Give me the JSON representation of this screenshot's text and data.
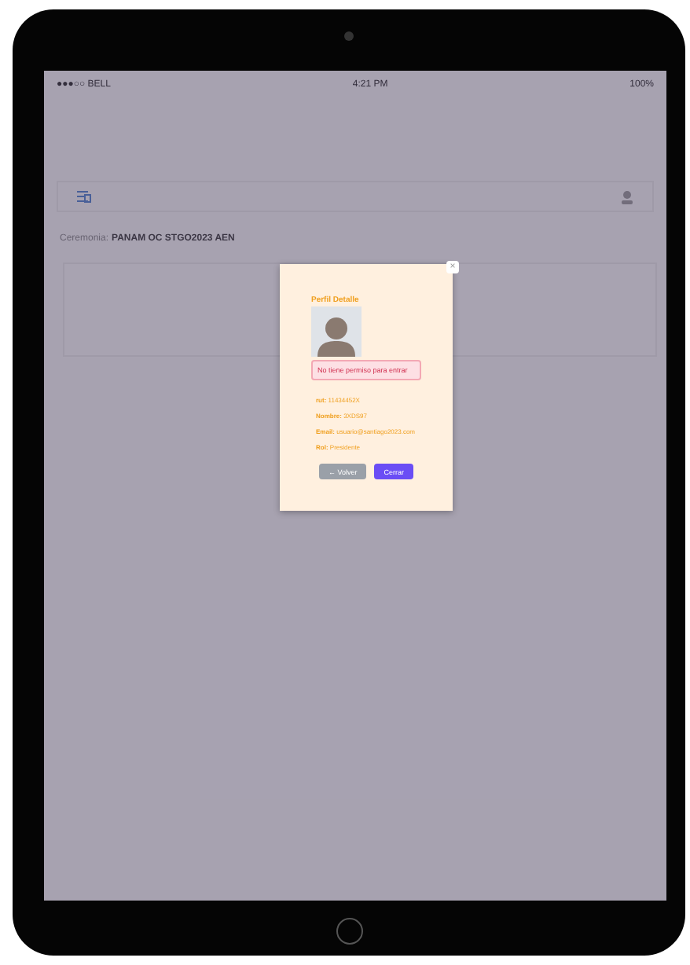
{
  "status_bar": {
    "carrier": "●●●○○ BELL",
    "time": "4:21 PM",
    "battery": "100%"
  },
  "header": {
    "label": "Ceremonia:",
    "value": "PANAM OC STGO2023 AEN"
  },
  "modal": {
    "title": "Perfil Detalle",
    "alert": "No tiene permiso para entrar",
    "fields": [
      {
        "label": "rut:",
        "value": "11434452X"
      },
      {
        "label": "Nombre:",
        "value": "3XDS97"
      },
      {
        "label": "Email:",
        "value": "usuario@santiago2023.com"
      },
      {
        "label": "Rol:",
        "value": "Presidente"
      }
    ],
    "close": "×",
    "buttons": [
      {
        "kind": "back",
        "label": "← Volver"
      },
      {
        "kind": "primary",
        "label": "Cerrar"
      }
    ]
  }
}
